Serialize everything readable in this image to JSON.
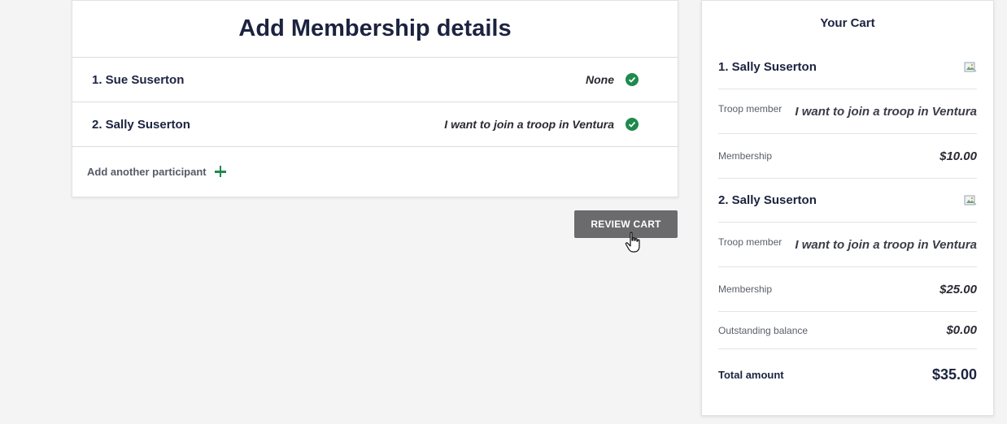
{
  "membership": {
    "title": "Add Membership details",
    "participants": [
      {
        "label": "1. Sue Suserton",
        "status": "None"
      },
      {
        "label": "2. Sally Suserton",
        "status": "I want to join a troop in Ventura"
      }
    ],
    "add_label": "Add another participant",
    "review_button": "REVIEW CART"
  },
  "cart": {
    "title": "Your Cart",
    "items": [
      {
        "name": "1. Sally Suserton",
        "troop_label": "Troop member",
        "troop_value": "I want to join a troop in Ventura",
        "membership_label": "Membership",
        "membership_value": "$10.00"
      },
      {
        "name": "2. Sally Suserton",
        "troop_label": "Troop member",
        "troop_value": "I want to join a troop in Ventura",
        "membership_label": "Membership",
        "membership_value": "$25.00"
      }
    ],
    "balance_label": "Outstanding balance",
    "balance_value": "$0.00",
    "total_label": "Total amount",
    "total_value": "$35.00"
  },
  "colors": {
    "accent_green": "#1e8a4c",
    "button_gray": "#6b6b6e",
    "heading_navy": "#1c2340"
  }
}
